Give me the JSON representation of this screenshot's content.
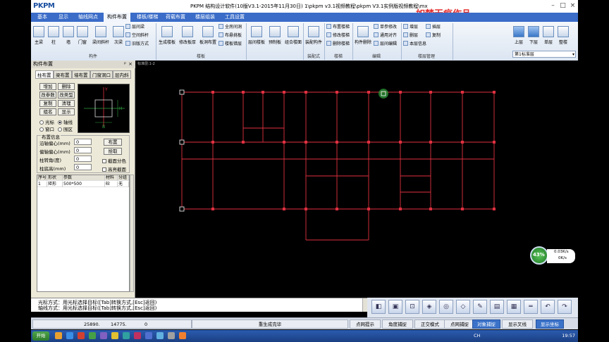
{
  "app": {
    "title": "PKPM 结构设计软件(10版V3.1-2015年11月30日) 1\\pkpm v3.1视频教程\\pkpm V3.1实例版视频教程\\mx",
    "logo": "PKPM",
    "watermark": "如梦无痕作品"
  },
  "tabs": [
    "基本",
    "显示",
    "轴线网点",
    "构件布置",
    "楼板/楼梯",
    "荷载布置",
    "楼层组装",
    "工具设置"
  ],
  "active_tab": "构件布置",
  "ribbon": {
    "groups": [
      {
        "label": "构件",
        "buttons": [
          "主梁",
          "柱",
          "墙",
          "门窗",
          "梁间斜杆",
          "次梁"
        ],
        "small": [
          "层间梁",
          "空间斜杆",
          "圈梁",
          "层间斜杆"
        ],
        "small2": [
          "旧版方式"
        ]
      },
      {
        "label": "楼板",
        "buttons": [
          "生成楼板",
          "修改板厚",
          "板洞布置",
          "全房间洞",
          "布悬挑板",
          "楼板错层"
        ],
        "small": [
          "全房间洞",
          "布悬挑板",
          "楼板错层"
        ]
      },
      {
        "label": "楼板",
        "buttons": [
          "层间楼板",
          "预制板",
          "组合楼面"
        ]
      },
      {
        "label": "装配式",
        "buttons": [
          "装配构件"
        ]
      },
      {
        "label": "楼梯",
        "small": [
          "布置楼梯",
          "修改楼梯",
          "删除楼梯"
        ]
      },
      {
        "label": "编辑",
        "buttons": [
          "构件删除"
        ],
        "small": [
          "单参修改",
          "通用对齐",
          "层间编辑"
        ]
      },
      {
        "label": "楼层管理",
        "small": [
          "增层",
          "删层",
          "本层信息",
          "插层",
          "复制"
        ]
      },
      {
        "label": "",
        "buttons": [
          "上层",
          "下层",
          "单层",
          "整楼"
        ]
      }
    ],
    "floor_select": "第1标准层"
  },
  "panel": {
    "title": "构件布置",
    "tabs": [
      "柱布置",
      "梁布置",
      "墙布置",
      "门窗洞口",
      "层内斜"
    ],
    "buttons": [
      "增加",
      "删除",
      "改参数",
      "改类型",
      "复制",
      "清理",
      "组名",
      "显示"
    ],
    "radios": [
      {
        "label": "光标",
        "on": false
      },
      {
        "label": "轴线",
        "on": true
      },
      {
        "label": "窗口",
        "on": false
      },
      {
        "label": "围区",
        "on": false
      }
    ],
    "info_title": "布置信息",
    "fields": [
      {
        "label": "沿轴偏心(mm)",
        "value": "0"
      },
      {
        "label": "偏轴偏心(mm)",
        "value": "0"
      },
      {
        "label": "柱转角(度)",
        "value": "0"
      },
      {
        "label": "柱底高(mm)",
        "value": "0"
      }
    ],
    "action_buttons": [
      "布置",
      "拾取"
    ],
    "checks": [
      "截面分色",
      "高亮截面"
    ],
    "table": {
      "headers": [
        "序号",
        "形状",
        "参数",
        "材料",
        "分组"
      ],
      "rows": [
        [
          "1",
          "矩形",
          "500*500",
          "砼",
          "无"
        ]
      ]
    },
    "preview_labels": [
      "Y",
      "H",
      "B"
    ]
  },
  "canvas": {
    "title": "标准层:1-2"
  },
  "command": {
    "line1": "光标方式：用光标选择目标([Tab]转换方式,[Esc]返回)",
    "line2": "轴线方式：用光标选择目标([Tab]转换方式,[Esc]返回)"
  },
  "status": {
    "x": "25890.",
    "y": "14775.",
    "z": "0",
    "message": "重生成完毕",
    "toggles": [
      "点网提示",
      "角度捕捉",
      "正交模式",
      "点网捕捉",
      "对象捕捉",
      "显示叉线",
      "显示坐标"
    ],
    "active_toggles": [
      "对象捕捉",
      "显示坐标"
    ]
  },
  "network": {
    "percent": "43%",
    "up": "0.03K/s",
    "down": "0K/s"
  },
  "taskbar": {
    "start": "开始",
    "time": "19:57",
    "lang": "CH"
  },
  "colors": {
    "tabbar": "#3a6cc8",
    "lines": "#e03040",
    "canvas_bg": "#000000",
    "accent_green": "#2e9a3a"
  }
}
